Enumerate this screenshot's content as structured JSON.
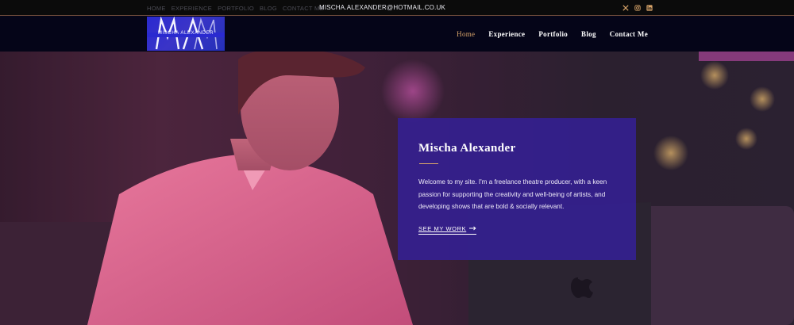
{
  "topbar": {
    "nav": [
      "HOME",
      "EXPERIENCE",
      "PORTFOLIO",
      "BLOG",
      "CONTACT ME"
    ],
    "email": "MISCHA.ALEXANDER@HOTMAIL.CO.UK",
    "social_icons": [
      "x-icon",
      "instagram-icon",
      "linkedin-icon"
    ],
    "social_color": "#d9a56a"
  },
  "header": {
    "logo_text": "MISCHA ALEXANDER",
    "nav": [
      "Home",
      "Experience",
      "Portfolio",
      "Blog",
      "Contact Me"
    ],
    "active": "Home",
    "accent": "#d9a56a"
  },
  "hero": {
    "title": "Mischa Alexander",
    "body": "Welcome to my site. I'm a freelance theatre producer, with a keen passion for supporting the creativity and well-being of artists, and developing shows that are bold & socially relevant.",
    "cta": "SEE MY WORK",
    "card_color": "#3420a0"
  }
}
